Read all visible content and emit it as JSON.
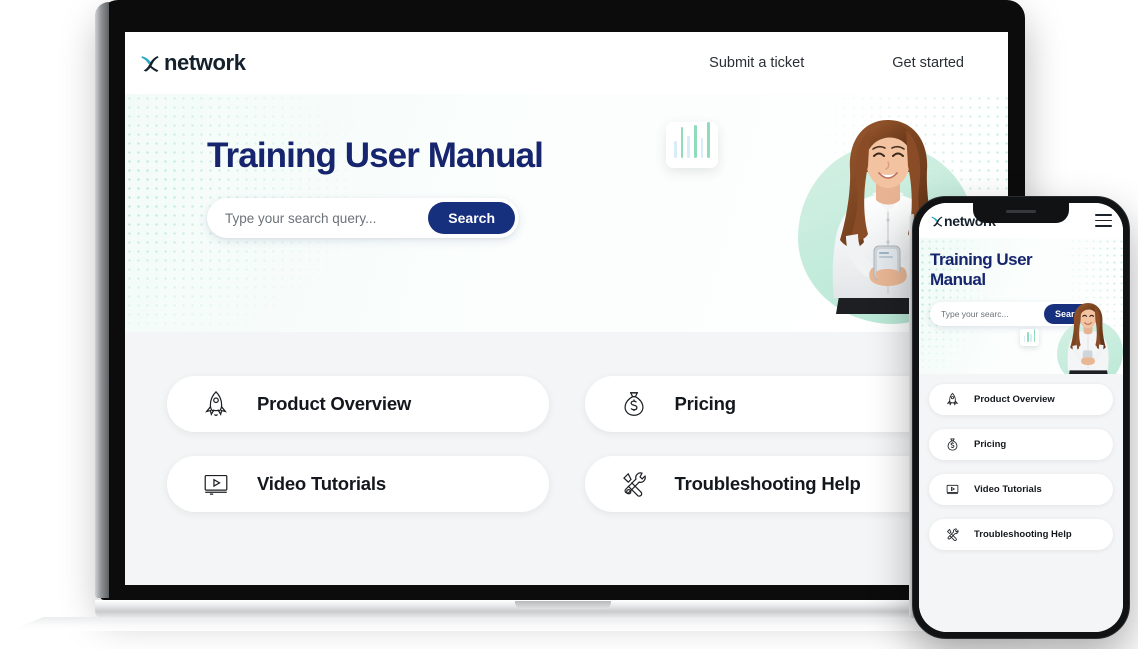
{
  "brand": {
    "name": "network",
    "logo_icon": "x-mark-icon",
    "logo_color": "#27a8c4",
    "text_color": "#14202b"
  },
  "nav": {
    "links": [
      {
        "label": "Submit a ticket",
        "name": "nav-link-submit-ticket"
      },
      {
        "label": "Get started",
        "name": "nav-link-get-started"
      }
    ],
    "mobile_menu_icon": "hamburger-menu-icon"
  },
  "hero": {
    "title": "Training User Manual",
    "title_color": "#16256e",
    "search": {
      "placeholder": "Type your search query...",
      "value": "",
      "button_label": "Search",
      "button_color": "#16307d"
    },
    "image_alt": "smiling-woman-using-smartphone",
    "accent_color": "#a9e2cd",
    "dot_pattern_color": "#57c9a4"
  },
  "hero_mobile": {
    "title": "Training User\nManual",
    "title_line1": "Training User",
    "title_line2": "Manual",
    "search": {
      "placeholder": "Type your searc...",
      "value": "",
      "button_label": "Search"
    }
  },
  "chart_badge": {
    "name": "bar-chart-badge",
    "bars": [
      {
        "height_pct": 48,
        "color": "#d9ecfa"
      },
      {
        "height_pct": 86,
        "color": "#8fdcbb"
      },
      {
        "height_pct": 60,
        "color": "#d9ecfa"
      },
      {
        "height_pct": 92,
        "color": "#8fdcbb"
      },
      {
        "height_pct": 55,
        "color": "#d9ecfa"
      },
      {
        "height_pct": 100,
        "color": "#8fdcbb"
      }
    ]
  },
  "cards": [
    {
      "label": "Product Overview",
      "icon": "rocket-icon",
      "name": "card-product-overview"
    },
    {
      "label": "Pricing",
      "icon": "money-bag-icon",
      "name": "card-pricing"
    },
    {
      "label": "Video Tutorials",
      "icon": "video-monitor-icon",
      "name": "card-video-tutorials"
    },
    {
      "label": "Troubleshooting Help",
      "icon": "wrench-screwdriver-icon",
      "name": "card-troubleshooting-help"
    }
  ],
  "devices": {
    "laptop": "laptop-mockup",
    "phone": "phone-mockup"
  }
}
